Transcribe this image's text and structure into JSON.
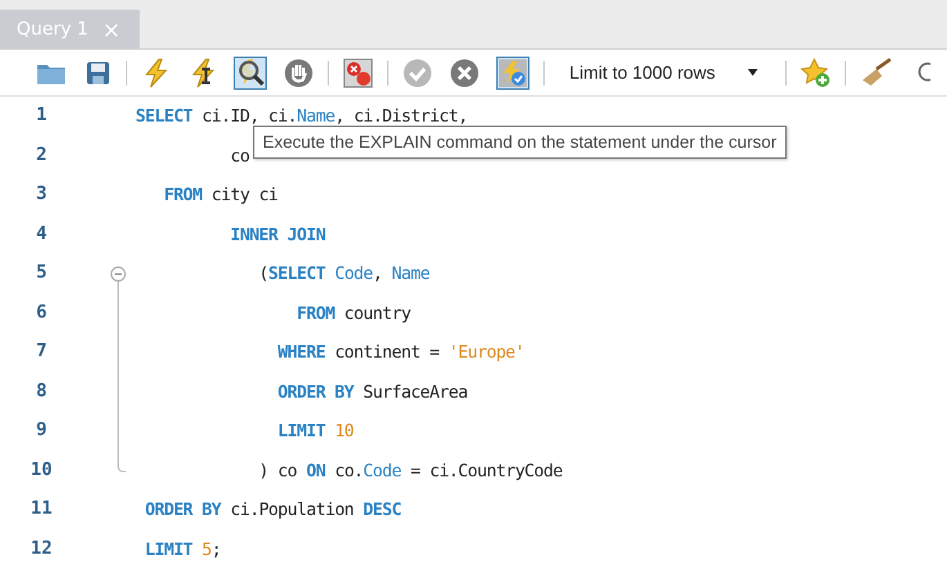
{
  "tabs": [
    {
      "label": "Query 1",
      "close": "×",
      "selected": true
    }
  ],
  "toolbar": [
    {
      "kind": "button",
      "selected": false,
      "disabled": false
    },
    {
      "kind": "button",
      "selected": false,
      "disabled": false
    },
    {
      "kind": "separator"
    },
    {
      "kind": "button",
      "selected": false,
      "disabled": false
    },
    {
      "kind": "button",
      "selected": false,
      "disabled": false
    },
    {
      "kind": "button",
      "selected": true,
      "disabled": false
    },
    {
      "kind": "button",
      "selected": false,
      "disabled": true
    },
    {
      "kind": "separator"
    },
    {
      "kind": "button",
      "selected": false,
      "disabled": false
    },
    {
      "kind": "separator"
    },
    {
      "kind": "button",
      "selected": false,
      "disabled": true
    },
    {
      "kind": "button",
      "selected": false,
      "disabled": true
    },
    {
      "kind": "button",
      "selected": true,
      "disabled": false
    },
    {
      "kind": "separator"
    },
    {
      "kind": "dropdown",
      "value": "Limit to 1000 rows"
    },
    {
      "kind": "separator"
    },
    {
      "kind": "button",
      "selected": false,
      "disabled": false
    },
    {
      "kind": "separator"
    },
    {
      "kind": "button",
      "selected": false,
      "disabled": false
    },
    {
      "kind": "button",
      "selected": false,
      "disabled": false
    }
  ],
  "editor": {
    "lines": [
      {
        "number": "1",
        "tokens": [
          {
            "kind": "keyword",
            "text": "SELECT"
          },
          {
            "kind": "plain",
            "text": " ci.ID, ci."
          },
          {
            "kind": "field",
            "text": "Name"
          },
          {
            "kind": "plain",
            "text": ", ci.District,"
          }
        ]
      },
      {
        "number": "2",
        "tokens": [
          {
            "kind": "plain",
            "text": "          co"
          }
        ]
      },
      {
        "number": "3",
        "tokens": [
          {
            "kind": "keyword",
            "text": "   FROM"
          },
          {
            "kind": "plain",
            "text": " city ci"
          }
        ]
      },
      {
        "number": "4",
        "tokens": [
          {
            "kind": "keyword",
            "text": "          INNER JOIN"
          }
        ]
      },
      {
        "number": "5",
        "kind": "fold-start",
        "tokens": [
          {
            "kind": "plain",
            "text": "             ("
          },
          {
            "kind": "keyword",
            "text": "SELECT"
          },
          {
            "kind": "field",
            "text": " Code"
          },
          {
            "kind": "plain",
            "text": ", "
          },
          {
            "kind": "field",
            "text": "Name"
          }
        ]
      },
      {
        "number": "6",
        "kind": "folded",
        "tokens": [
          {
            "kind": "keyword",
            "text": "                 FROM"
          },
          {
            "kind": "plain",
            "text": " country"
          }
        ]
      },
      {
        "number": "7",
        "kind": "folded",
        "tokens": [
          {
            "kind": "keyword",
            "text": "               WHERE"
          },
          {
            "kind": "plain",
            "text": " continent = "
          },
          {
            "kind": "string",
            "text": "'Europe'"
          }
        ]
      },
      {
        "number": "8",
        "kind": "folded",
        "tokens": [
          {
            "kind": "keyword",
            "text": "               ORDER BY"
          },
          {
            "kind": "plain",
            "text": " SurfaceArea"
          }
        ]
      },
      {
        "number": "9",
        "kind": "folded",
        "tokens": [
          {
            "kind": "keyword",
            "text": "               LIMIT"
          },
          {
            "kind": "number",
            "text": " 10"
          }
        ]
      },
      {
        "number": "10",
        "kind": "fold-end",
        "tokens": [
          {
            "kind": "plain",
            "text": "             ) co "
          },
          {
            "kind": "keyword",
            "text": "ON"
          },
          {
            "kind": "plain",
            "text": " co."
          },
          {
            "kind": "field",
            "text": "Code"
          },
          {
            "kind": "plain",
            "text": " = ci.CountryCode"
          }
        ]
      },
      {
        "number": "11",
        "tokens": [
          {
            "kind": "keyword",
            "text": " ORDER BY"
          },
          {
            "kind": "plain",
            "text": " ci.Population "
          },
          {
            "kind": "keyword",
            "text": "DESC"
          }
        ]
      },
      {
        "number": "12",
        "tokens": [
          {
            "kind": "keyword",
            "text": " LIMIT"
          },
          {
            "kind": "number",
            "text": " 5"
          },
          {
            "kind": "plain",
            "text": ";"
          }
        ]
      }
    ]
  },
  "tooltip": {
    "text": "Execute the EXPLAIN command on the statement under the cursor"
  }
}
